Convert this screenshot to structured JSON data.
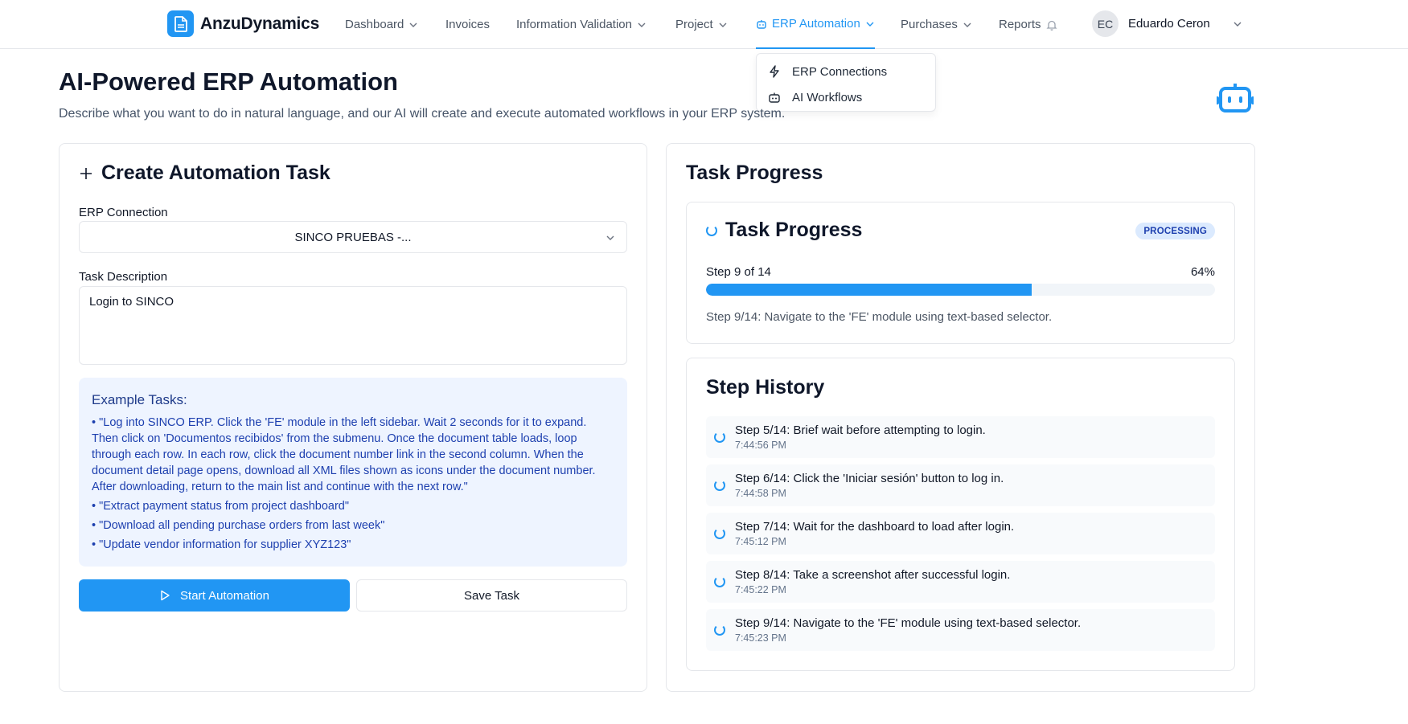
{
  "brand": {
    "name": "AnzuDynamics"
  },
  "nav": [
    {
      "label": "Dashboard",
      "has_chevron": true
    },
    {
      "label": "Invoices",
      "has_chevron": false
    },
    {
      "label": "Information Validation",
      "has_chevron": true
    },
    {
      "label": "Project",
      "has_chevron": true
    },
    {
      "label": "ERP Automation",
      "has_chevron": true,
      "active": true
    },
    {
      "label": "Purchases",
      "has_chevron": true
    },
    {
      "label": "Reports",
      "has_chevron": false
    }
  ],
  "user": {
    "initials": "EC",
    "name": "Eduardo Ceron"
  },
  "dropdown": {
    "items": [
      {
        "label": "ERP Connections",
        "icon": "lightning-icon"
      },
      {
        "label": "AI Workflows",
        "icon": "robot-icon"
      }
    ]
  },
  "header": {
    "title": "AI-Powered ERP Automation",
    "subtitle": "Describe what you want to do in natural language, and our AI will create and execute automated workflows in your ERP system."
  },
  "create": {
    "title": "Create Automation Task",
    "erp_label": "ERP Connection",
    "erp_value": "SINCO PRUEBAS -...",
    "task_label": "Task Description",
    "task_value": "Login to SINCO",
    "examples_title": "Example Tasks:",
    "examples": [
      "• \"Log into SINCO ERP. Click the 'FE' module in the left sidebar. Wait 2 seconds for it to expand. Then click on 'Documentos recibidos' from the submenu. Once the document table loads, loop through each row. In each row, click the document number link in the second column. When the document detail page opens, download all XML files shown as icons under the document number. After downloading, return to the main list and continue with the next row.\"",
      "• \"Extract payment status from project dashboard\"",
      "• \"Download all pending purchase orders from last week\"",
      "• \"Update vendor information for supplier XYZ123\""
    ],
    "start_label": "Start Automation",
    "save_label": "Save Task"
  },
  "progress": {
    "panel_title": "Task Progress",
    "card_title": "Task Progress",
    "status": "PROCESSING",
    "step_count": "Step 9 of 14",
    "percent_label": "64%",
    "percent": 64,
    "description": "Step 9/14: Navigate to the 'FE' module using text-based selector."
  },
  "history": {
    "title": "Step History",
    "items": [
      {
        "text": "Step 5/14: Brief wait before attempting to login.",
        "time": "7:44:56 PM"
      },
      {
        "text": "Step 6/14: Click the 'Iniciar sesión' button to log in.",
        "time": "7:44:58 PM"
      },
      {
        "text": "Step 7/14: Wait for the dashboard to load after login.",
        "time": "7:45:12 PM"
      },
      {
        "text": "Step 8/14: Take a screenshot after successful login.",
        "time": "7:45:22 PM"
      },
      {
        "text": "Step 9/14: Navigate to the 'FE' module using text-based selector.",
        "time": "7:45:23 PM"
      }
    ]
  },
  "colors": {
    "accent": "#2196f3",
    "examples_bg": "#eef4ff",
    "badge_bg": "#dbeafe"
  }
}
